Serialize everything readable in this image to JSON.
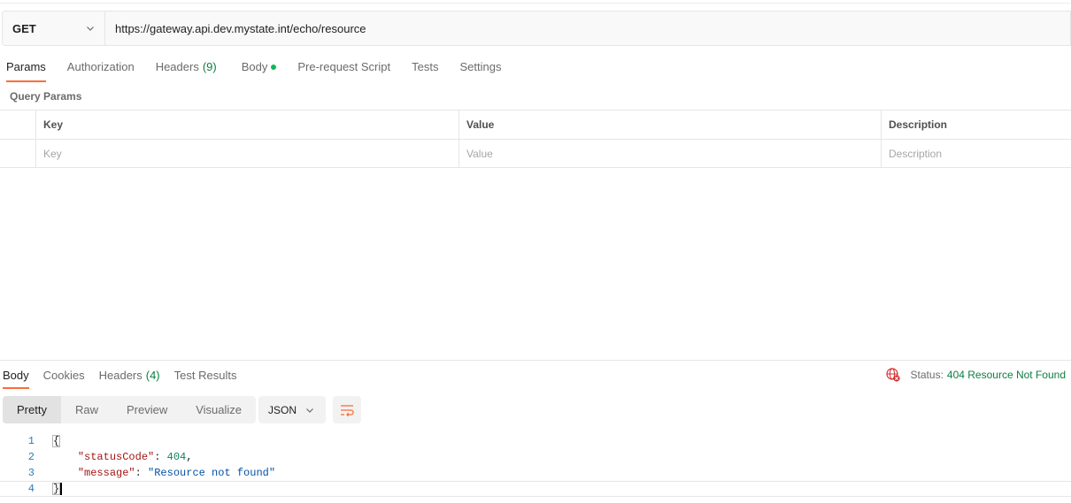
{
  "request": {
    "method": "GET",
    "url": "https://gateway.api.dev.mystate.int/echo/resource"
  },
  "request_tabs": [
    {
      "label": "Params",
      "active": true
    },
    {
      "label": "Authorization"
    },
    {
      "label": "Headers",
      "count": "(9)"
    },
    {
      "label": "Body",
      "dot": true
    },
    {
      "label": "Pre-request Script"
    },
    {
      "label": "Tests"
    },
    {
      "label": "Settings"
    }
  ],
  "params": {
    "title": "Query Params",
    "headers": {
      "key": "Key",
      "value": "Value",
      "description": "Description"
    },
    "placeholder": {
      "key": "Key",
      "value": "Value",
      "description": "Description"
    }
  },
  "response_tabs": [
    {
      "label": "Body",
      "active": true
    },
    {
      "label": "Cookies"
    },
    {
      "label": "Headers",
      "count": "(4)"
    },
    {
      "label": "Test Results"
    }
  ],
  "status": {
    "label": "Status:",
    "value": "404 Resource Not Found",
    "icon": "globe-error-icon"
  },
  "view_tabs": [
    {
      "label": "Pretty",
      "active": true
    },
    {
      "label": "Raw"
    },
    {
      "label": "Preview"
    },
    {
      "label": "Visualize"
    }
  ],
  "format": "JSON",
  "code": {
    "lines": [
      "1",
      "2",
      "3",
      "4"
    ],
    "open_brace": "{",
    "close_brace": "}",
    "k1": "\"statusCode\"",
    "v1": "404",
    "k2": "\"message\"",
    "v2": "\"Resource not found\"",
    "colon": ": ",
    "comma": ","
  },
  "colors": {
    "accent": "#ff6c37",
    "success": "#0c7f3f",
    "error": "#d32f2f"
  }
}
